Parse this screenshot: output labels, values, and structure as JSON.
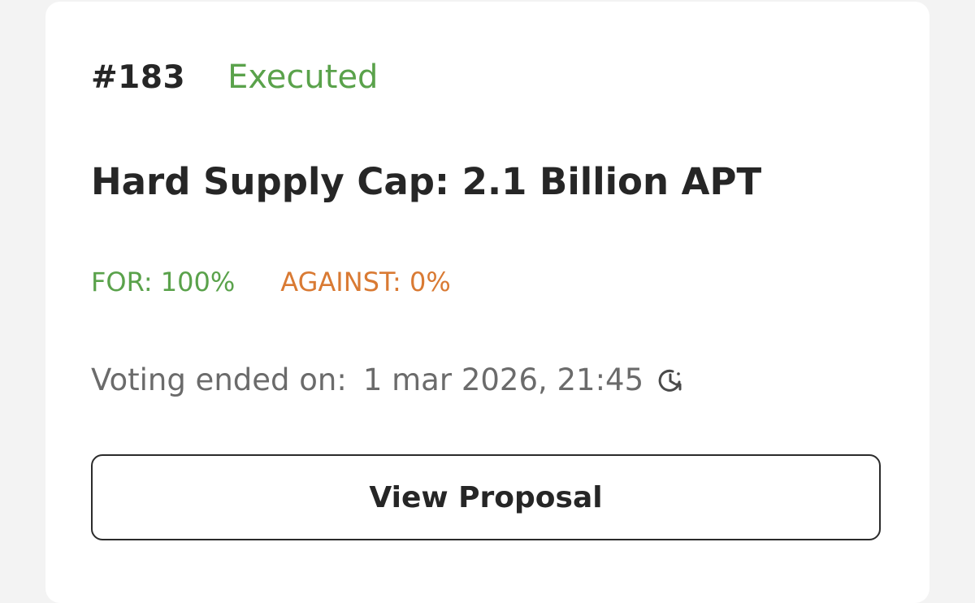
{
  "proposal": {
    "number": "#183",
    "status": "Executed",
    "title": "Hard Supply Cap: 2.1 Billion APT",
    "votes": {
      "for_label": "FOR: 100%",
      "against_label": "AGAINST: 0%"
    },
    "voting": {
      "label": "Voting ended on:",
      "date": "1 mar 2026, 21:45",
      "icon": "clock-icon"
    },
    "action": {
      "button_label": "View Proposal"
    }
  },
  "colors": {
    "status_executed": "#5aa24b",
    "vote_for": "#5aa24b",
    "vote_against": "#d97a33",
    "text_primary": "#262626",
    "text_secondary": "#6b6b6b",
    "background": "#f3f3f3",
    "card": "#ffffff"
  }
}
